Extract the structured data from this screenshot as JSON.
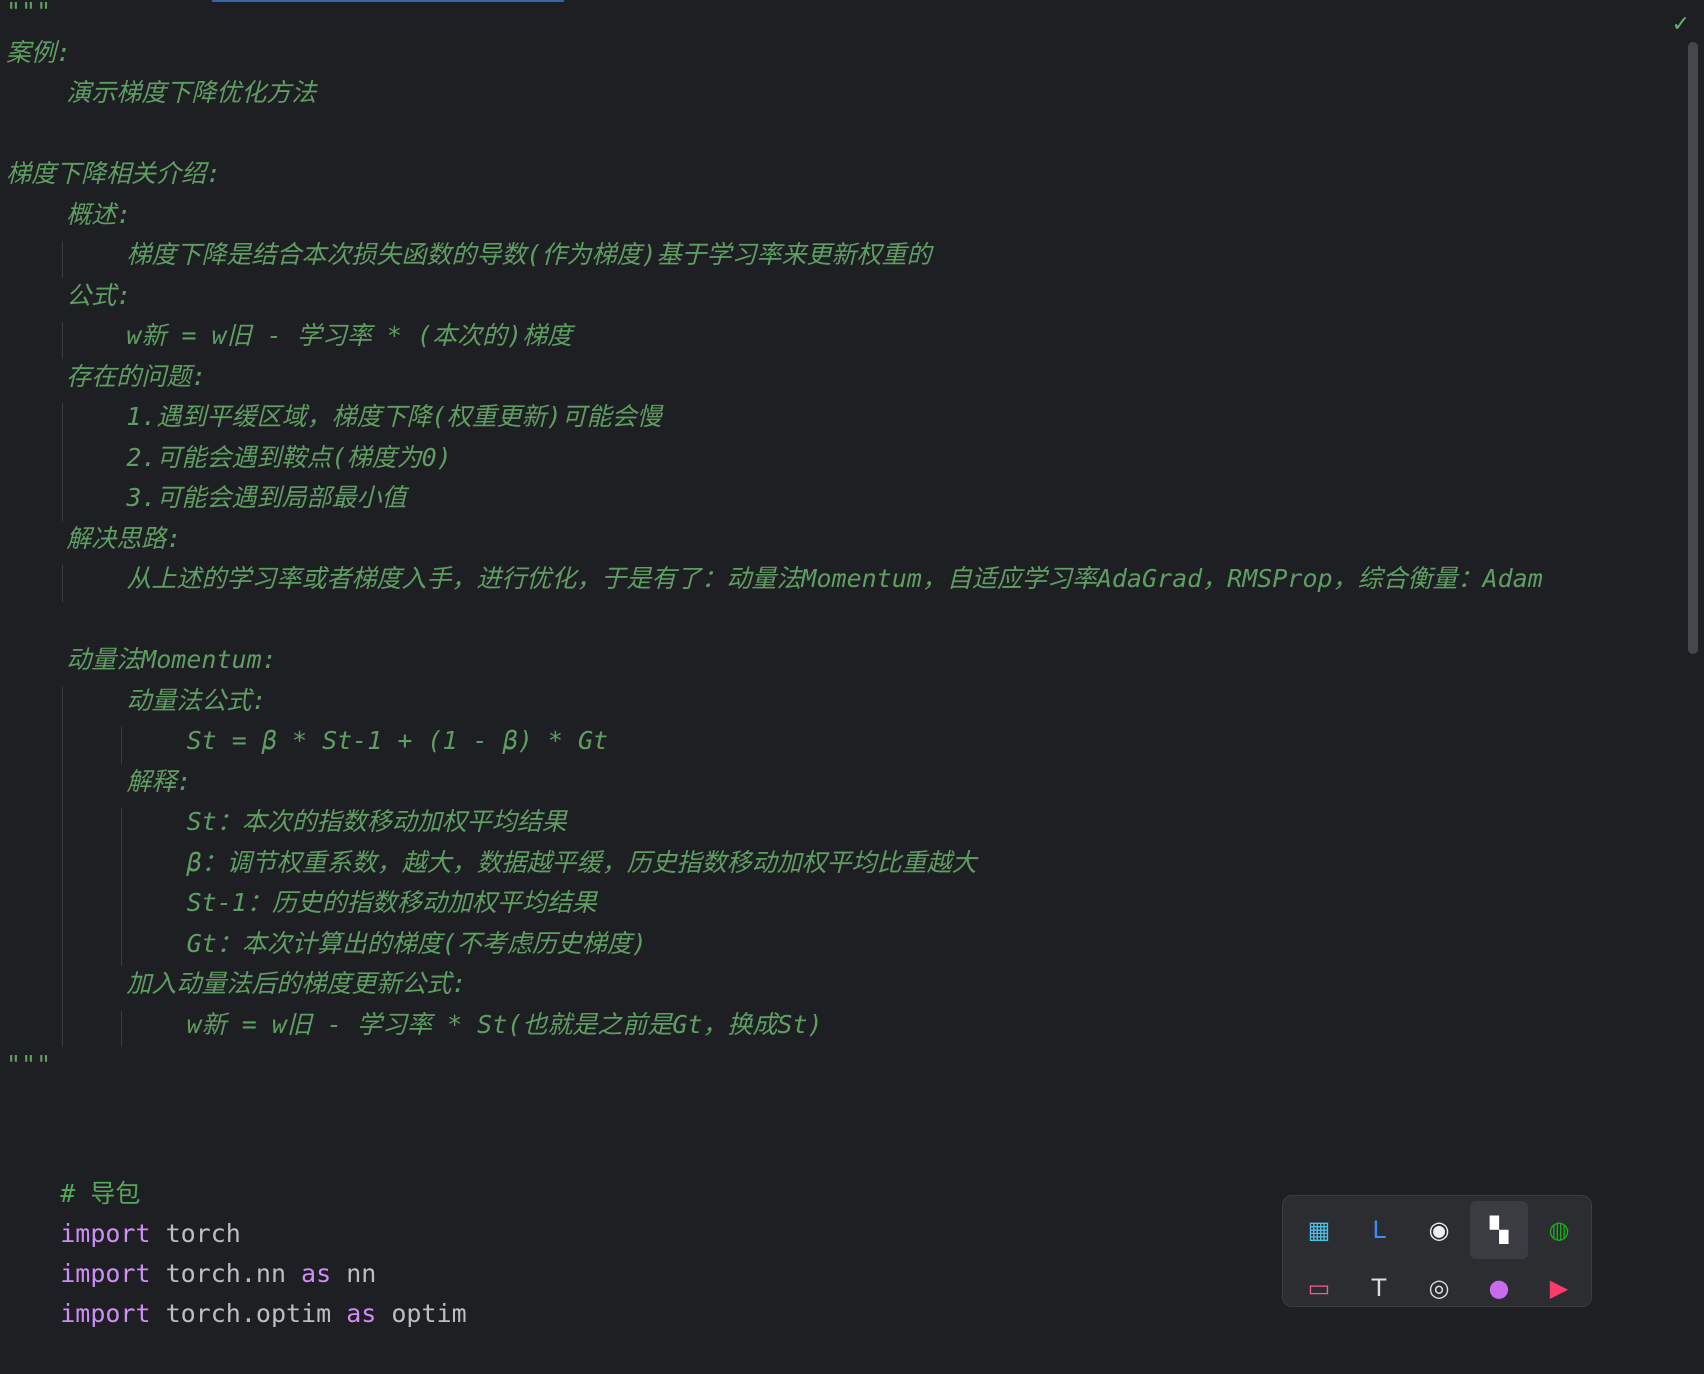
{
  "editor": {
    "lines": [
      "\"\"\"",
      "案例:",
      "    演示梯度下降优化方法",
      "",
      "梯度下降相关介绍:",
      "    概述:",
      "        梯度下降是结合本次损失函数的导数(作为梯度)基于学习率来更新权重的",
      "    公式:",
      "        w新 = w旧 - 学习率 * (本次的)梯度",
      "    存在的问题:",
      "        1.遇到平缓区域，梯度下降(权重更新)可能会慢",
      "        2.可能会遇到鞍点(梯度为0)",
      "        3.可能会遇到局部最小值",
      "    解决思路:",
      "        从上述的学习率或者梯度入手，进行优化，于是有了：动量法Momentum，自适应学习率AdaGrad，RMSProp，综合衡量：Adam",
      "",
      "    动量法Momentum:",
      "        动量法公式:",
      "            St = β * St-1 + (1 - β) * Gt",
      "        解释:",
      "            St：本次的指数移动加权平均结果",
      "            β：调节权重系数，越大，数据越平缓，历史指数移动加权平均比重越大",
      "            St-1：历史的指数移动加权平均结果",
      "            Gt：本次计算出的梯度(不考虑历史梯度)",
      "        加入动量法后的梯度更新公式:",
      "            w新 = w旧 - 学习率 * St(也就是之前是Gt，换成St)",
      "\"\"\"",
      ""
    ],
    "comment": "# 导包",
    "import_kw": "import",
    "as_kw": "as",
    "import1_module": " torch",
    "import2_module": " torch.nn ",
    "import2_alias": " nn",
    "import3_module": " torch.optim ",
    "import3_alias": " optim",
    "check_mark": "✓"
  },
  "tray": {
    "icons": [
      {
        "name": "pycharm-icon",
        "glyph": "▦",
        "color": "#4fc1e9"
      },
      {
        "name": "shield-l-icon",
        "glyph": "L",
        "color": "#3a8ef6"
      },
      {
        "name": "qq-penguin-icon",
        "glyph": "◉",
        "color": "#eeeeee"
      },
      {
        "name": "bookmark-app-icon",
        "glyph": "▚",
        "color": "#ffffff"
      },
      {
        "name": "wechat-icon",
        "glyph": "◍",
        "color": "#1aad19"
      },
      {
        "name": "bilibili-icon",
        "glyph": "▭",
        "color": "#f25d8e"
      },
      {
        "name": "typora-icon",
        "glyph": "T",
        "color": "#dddddd"
      },
      {
        "name": "camera-icon",
        "glyph": "◎",
        "color": "#dddddd"
      },
      {
        "name": "music-icon",
        "glyph": "●",
        "color": "#c86bf0"
      },
      {
        "name": "video-play-icon",
        "glyph": "▶",
        "color": "#ff3b6b"
      }
    ]
  }
}
